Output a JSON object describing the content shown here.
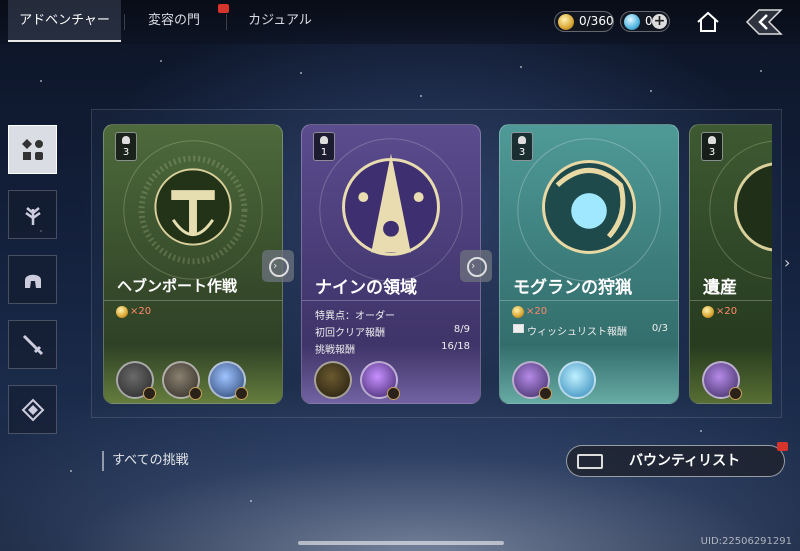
{
  "tabs": [
    {
      "label": "アドベンチャー",
      "active": true
    },
    {
      "label": "変容の門",
      "notification": true
    },
    {
      "label": "カジュアル"
    }
  ],
  "currency": {
    "gold": "0/360",
    "blue": "0"
  },
  "sidebar": {
    "items": [
      {
        "icon": "grid-icon",
        "active": true
      },
      {
        "icon": "wheat-icon"
      },
      {
        "icon": "helmet-icon"
      },
      {
        "icon": "sword-icon"
      },
      {
        "icon": "diamond-emblem-icon"
      }
    ]
  },
  "cards": [
    {
      "badge": "3",
      "title": "ヘブンポート作戦",
      "cost": "×20",
      "theme": "#3e5530"
    },
    {
      "badge": "1",
      "title": "ナインの領域",
      "rows": [
        {
          "label": "特異点：オーダー",
          "value": ""
        },
        {
          "label": "初回クリア報酬",
          "value": "8/9"
        },
        {
          "label": "挑戦報酬",
          "value": "16/18"
        }
      ],
      "theme": "#5a4a86"
    },
    {
      "badge": "3",
      "title": "モグランの狩猟",
      "cost": "×20",
      "rows": [
        {
          "label": "ウィッシュリスト報酬",
          "value": "0/3"
        }
      ],
      "theme": "#3c7a7a"
    },
    {
      "badge": "3",
      "title": "遺産",
      "cost": "×20",
      "theme": "#2e4526"
    }
  ],
  "all_challenges": "すべての挑戦",
  "bounty_list": "バウンティリスト",
  "uid": "UID:22506291291"
}
